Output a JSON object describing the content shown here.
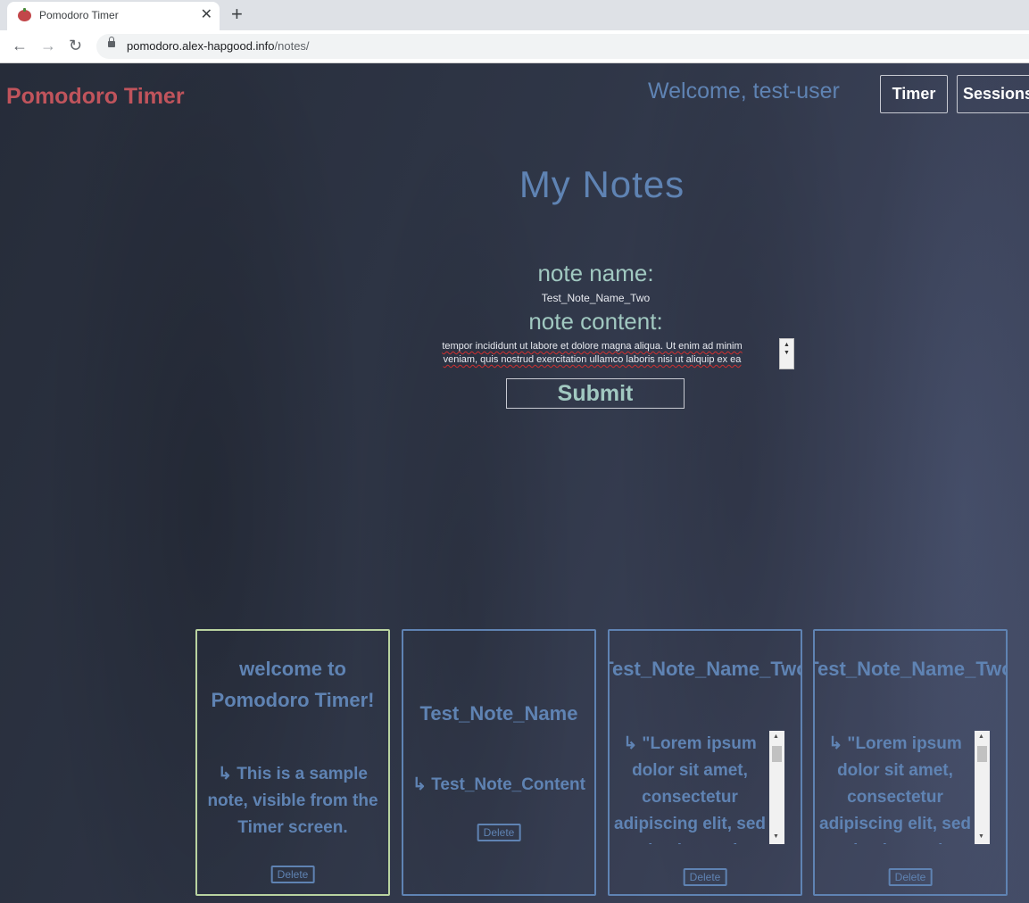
{
  "browser": {
    "tab_title": "Pomodoro Timer",
    "tab_close": "✕",
    "new_tab": "+",
    "back": "←",
    "forward": "→",
    "reload": "↻",
    "url_host": "pomodoro.alex-hapgood.info",
    "url_path": "/notes/"
  },
  "header": {
    "brand": "Pomodoro Timer",
    "welcome": "Welcome, test-user",
    "nav": [
      "Timer",
      "Sessions"
    ]
  },
  "page_title": "My Notes",
  "form": {
    "name_label": "note name:",
    "name_value": "Test_Note_Name_Two",
    "content_label": "note content:",
    "content_lines": [
      "tempor incididunt ut labore et dolore magna aliqua. Ut enim ad minim",
      "veniam, quis nostrud exercitation ullamco laboris nisi ut aliquip ex ea"
    ],
    "submit_label": "Submit"
  },
  "notes": [
    {
      "title": "welcome to Pomodoro Timer!",
      "content": "↳ This is a sample note, visible from the Timer screen.",
      "delete_label": "Delete"
    },
    {
      "title": "Test_Note_Name",
      "content": "↳ Test_Note_Content",
      "delete_label": "Delete"
    },
    {
      "title": "Test_Note_Name_Two",
      "content": "↳ \"Lorem ipsum dolor sit amet, consectetur adipiscing elit, sed do eiusmod tempor",
      "delete_label": "Delete"
    },
    {
      "title": "Test_Note_Name_Two",
      "content": "↳ \"Lorem ipsum dolor sit amet, consectetur adipiscing elit, sed do eiusmod tempor",
      "delete_label": "Delete"
    }
  ],
  "colors": {
    "brand": "#c0545c",
    "accent_blue": "#5f83b3",
    "accent_teal": "#a1c9c1",
    "highlight_border": "#b9d3a0"
  }
}
